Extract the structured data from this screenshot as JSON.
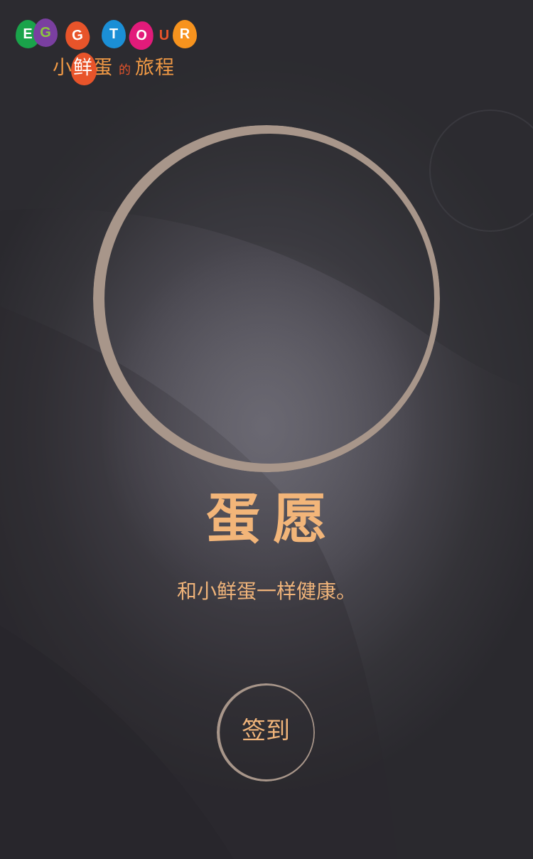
{
  "logo": {
    "letters": [
      {
        "char": "E",
        "color": "#1aa34a"
      },
      {
        "char": "G",
        "color": "#7a3fa0",
        "text_color": "#8cc63f"
      },
      {
        "char": "G",
        "color": "#e8542a"
      },
      {
        "char": "T",
        "color": "#1b8fd6"
      },
      {
        "char": "O",
        "color": "#e21b7a"
      },
      {
        "char": "U",
        "color": "#e8542a",
        "text_color": "#e8542a",
        "outline": true
      },
      {
        "char": "R",
        "color": "#f7931e"
      }
    ],
    "cn_part1": "小",
    "cn_egg_char1": "鲜",
    "cn_part2": "蛋",
    "cn_small": "的",
    "cn_part3": "旅程"
  },
  "main": {
    "title": "蛋愿",
    "subtitle": "和小鲜蛋一样健康。"
  },
  "checkin_button": {
    "label": "签到"
  },
  "colors": {
    "accent": "#f0b47a",
    "ring": "#a8968a",
    "background": "#2b2a2f"
  }
}
